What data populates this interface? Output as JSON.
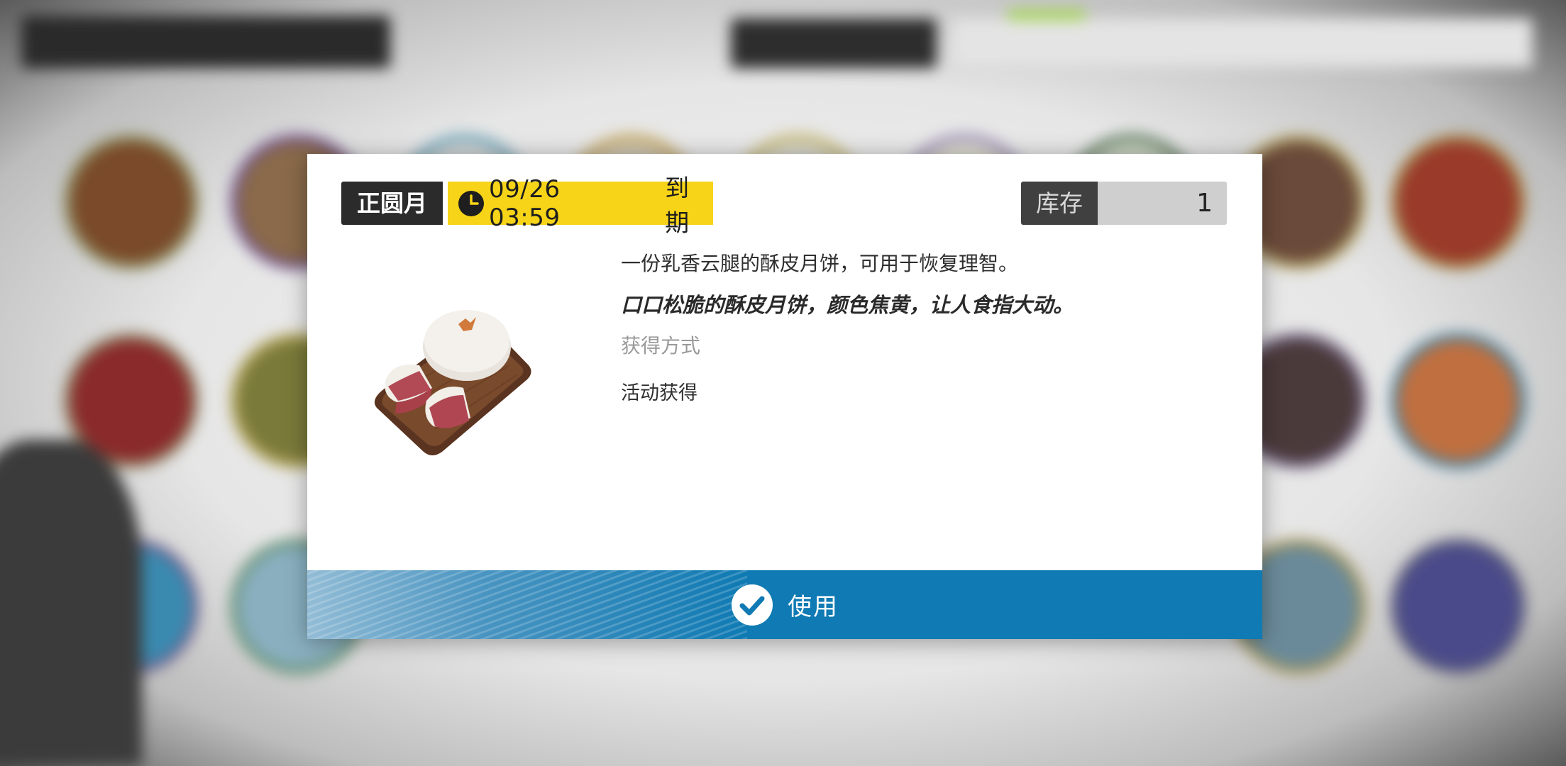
{
  "dialog": {
    "category_tag": "正圆月",
    "expire_time": "09/26 03:59",
    "expire_suffix": "到期",
    "stock_label": "库存",
    "stock_value": "1",
    "item_icon": "mooncake-image",
    "description": "一份乳香云腿的酥皮月饼，可用于恢复理智。",
    "flavor_text": "口口松脆的酥皮月饼，颜色焦黄，让人食指大动。",
    "obtain_title": "获得方式",
    "obtain_value": "活动获得",
    "use_label": "使用"
  },
  "colors": {
    "expire_tag": "#f7d417",
    "use_bar": "#0f7ab3",
    "dark_tag": "#2b2b2b"
  }
}
